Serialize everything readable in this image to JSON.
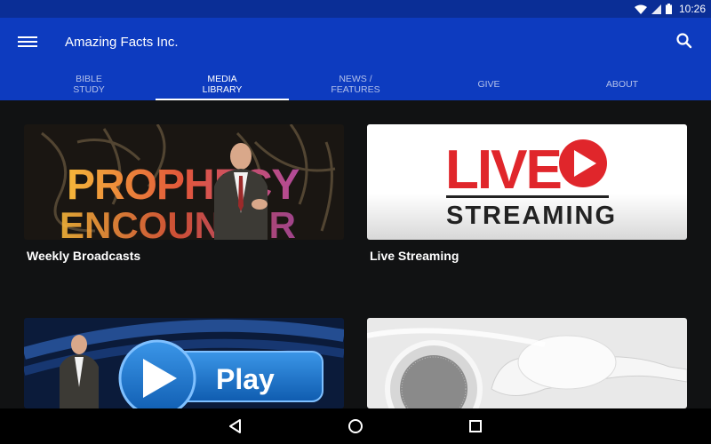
{
  "status_bar": {
    "time": "10:26",
    "icons": [
      "wifi-icon",
      "signal-icon",
      "battery-icon"
    ]
  },
  "app_bar": {
    "title": "Amazing Facts Inc.",
    "menu_icon": "hamburger-menu-icon",
    "search_icon": "search-icon"
  },
  "tabs": [
    {
      "label": "BIBLE\nSTUDY",
      "active": false
    },
    {
      "label": "MEDIA\nLIBRARY",
      "active": true
    },
    {
      "label": "NEWS /\nFEATURES",
      "active": false
    },
    {
      "label": "GIVE",
      "active": false
    },
    {
      "label": "ABOUT",
      "active": false
    }
  ],
  "cards": [
    {
      "title": "Weekly Broadcasts",
      "image_text": [
        "PROPHECY",
        "ENCOUNTER"
      ]
    },
    {
      "title": "Live Streaming",
      "image_text": [
        "LIVE",
        "STREAMING"
      ]
    },
    {
      "title": "",
      "image_text": [
        "Play"
      ]
    },
    {
      "title": "",
      "image_text": []
    }
  ],
  "nav_bar": {
    "buttons": [
      "back-icon",
      "home-icon",
      "recents-icon"
    ]
  },
  "colors": {
    "status_bar": "#0a2e96",
    "app_bar": "#0d3bbf",
    "background": "#111213",
    "live_red": "#e0262b"
  }
}
